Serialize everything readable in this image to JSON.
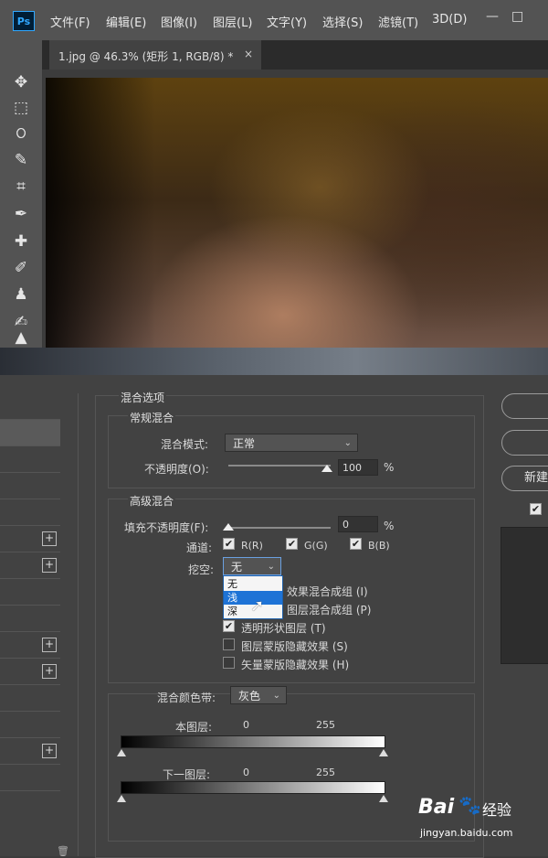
{
  "app": {
    "logo": "Ps",
    "menus": [
      "文件(F)",
      "编辑(E)",
      "图像(I)",
      "图层(L)",
      "文字(Y)",
      "选择(S)",
      "滤镜(T)",
      "3D(D)"
    ]
  },
  "window_controls": {
    "minimize": "—",
    "restore": "□"
  },
  "document_tab": {
    "title": "1.jpg @ 46.3% (矩形 1, RGB/8) *",
    "close": "×"
  },
  "tools": [
    "move-icon",
    "marquee-icon",
    "lasso-icon",
    "quick-select-icon",
    "crop-icon",
    "eyedropper-icon",
    "healing-icon",
    "brush-icon",
    "stamp-icon",
    "history-brush-icon",
    "eraser-icon"
  ],
  "dialog": {
    "section_title": "混合选项",
    "general": {
      "title": "常规混合",
      "blend_mode_label": "混合模式:",
      "blend_mode_value": "正常",
      "opacity_label": "不透明度(O):",
      "opacity_value": "100",
      "opacity_unit": "%"
    },
    "advanced": {
      "title": "高级混合",
      "fill_label": "填充不透明度(F):",
      "fill_value": "0",
      "fill_unit": "%",
      "channels_label": "通道:",
      "channel_r": "R(R)",
      "channel_g": "G(G)",
      "channel_b": "B(B)",
      "knockout_label": "挖空:",
      "knockout_value": "无",
      "knockout_options": [
        "无",
        "浅",
        "深"
      ],
      "opt1": "效果混合成组 (I)",
      "opt2": "图层混合成组 (P)",
      "opt3": "透明形状图层 (T)",
      "opt4": "图层蒙版隐藏效果 (S)",
      "opt5": "矢量蒙版隐藏效果 (H)"
    },
    "blend_if": {
      "label": "混合颜色带:",
      "value": "灰色",
      "this_layer": "本图层:",
      "this_min": "0",
      "this_max": "255",
      "underlying": "下一图层:",
      "under_min": "0",
      "under_max": "255"
    },
    "right": {
      "new_style_label": "新建"
    }
  },
  "watermark": {
    "brand": "Bai",
    "brand2": "经验",
    "url": "jingyan.baidu.com"
  }
}
